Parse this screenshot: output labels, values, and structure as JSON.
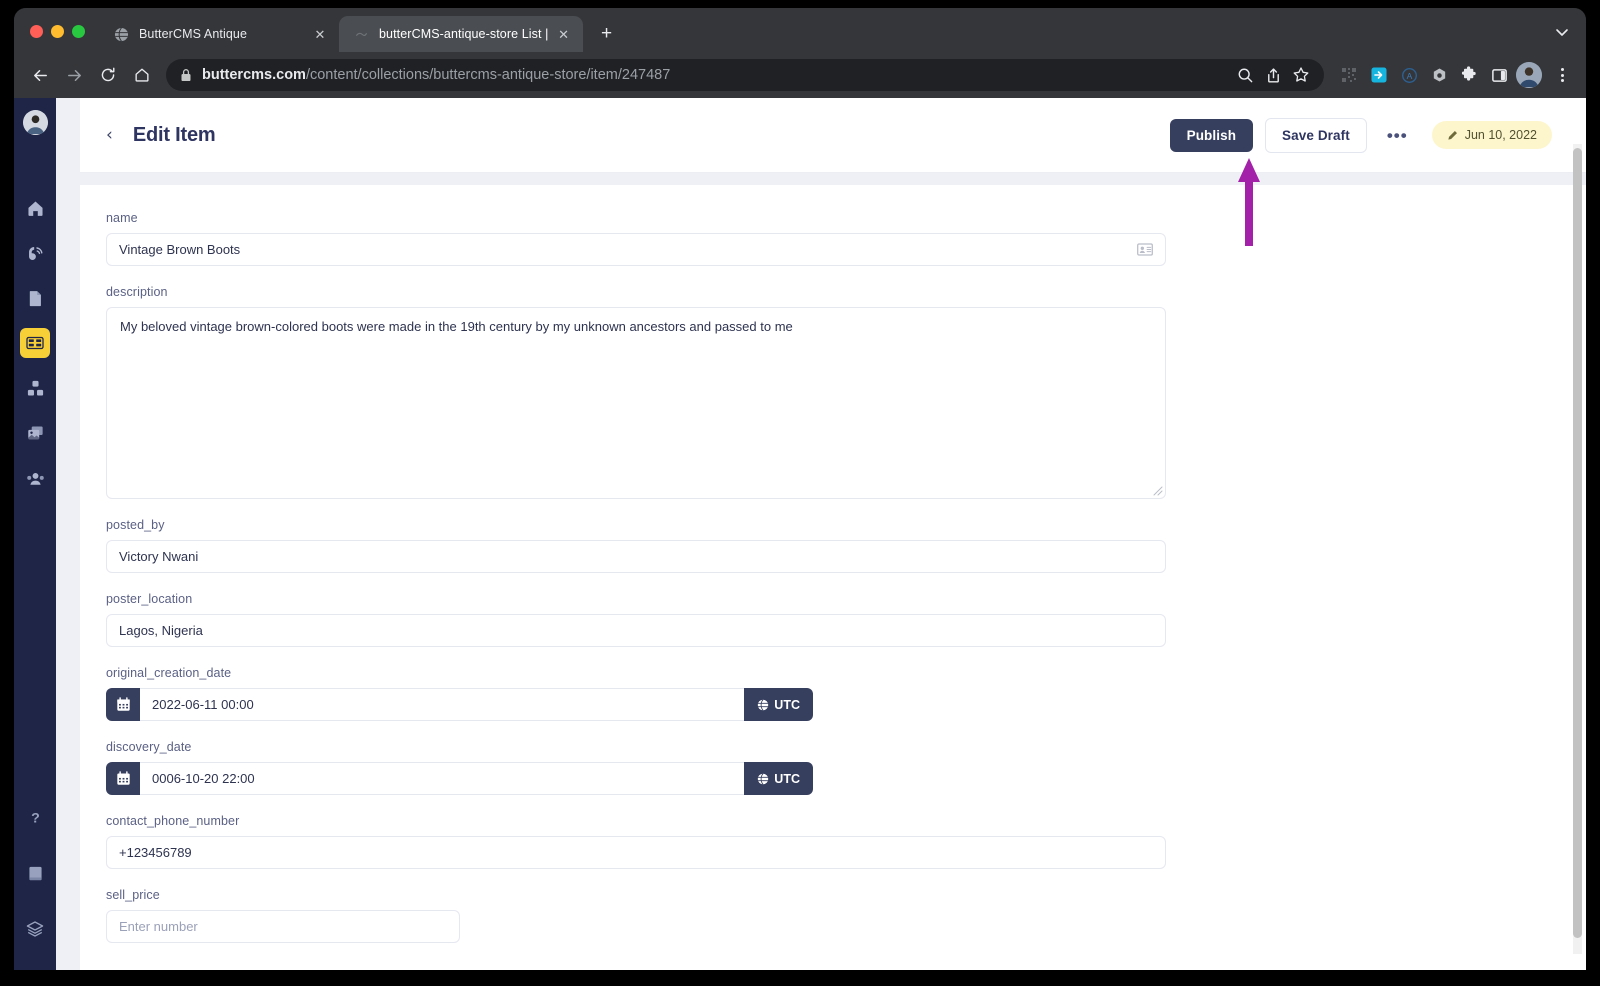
{
  "browser": {
    "window_controls": [
      "close",
      "minimize",
      "maximize"
    ],
    "tabs": [
      {
        "title": "ButterCMS Antique",
        "favicon": "globe-icon",
        "active": false
      },
      {
        "title": "butterCMS-antique-store List |",
        "favicon": "globe-icon",
        "active": true
      }
    ],
    "new_tab_label": "+",
    "tab_list_chevron": "chevron-down-icon",
    "nav": {
      "back": "back-arrow-icon",
      "forward": "forward-arrow-icon",
      "reload": "reload-icon",
      "home": "home-icon"
    },
    "omnibox": {
      "lock": "lock-icon",
      "url_domain": "buttercms.com",
      "url_path": "/content/collections/buttercms-antique-store/item/247487",
      "actions": [
        "search-icon",
        "share-icon",
        "bookmark-star-icon"
      ]
    },
    "extensions": [
      "qr-code-icon",
      "export-icon",
      "grammarly-icon",
      "nut-icon",
      "puzzle-extensions-icon",
      "side-panel-icon"
    ],
    "profile_avatar": "profile-avatar",
    "menu": "kebab-menu-icon"
  },
  "sidebar": {
    "avatar": "user-avatar",
    "items": [
      {
        "name": "home",
        "icon": "home-icon",
        "active": false
      },
      {
        "name": "blog",
        "icon": "blog-rss-icon",
        "active": false
      },
      {
        "name": "pages",
        "icon": "page-document-icon",
        "active": false
      },
      {
        "name": "collections",
        "icon": "collections-grid-icon",
        "active": true
      },
      {
        "name": "components",
        "icon": "components-blocks-icon",
        "active": false
      },
      {
        "name": "media",
        "icon": "media-images-icon",
        "active": false
      },
      {
        "name": "team",
        "icon": "team-users-icon",
        "active": false
      }
    ],
    "bottom_items": [
      {
        "name": "help",
        "icon": "question-mark-icon"
      },
      {
        "name": "docs",
        "icon": "book-icon"
      },
      {
        "name": "stack",
        "icon": "layers-stack-icon"
      }
    ]
  },
  "header": {
    "back_chevron": "chevron-left-icon",
    "title": "Edit Item",
    "publish_label": "Publish",
    "save_draft_label": "Save Draft",
    "more_label": "•••",
    "date_badge": {
      "icon": "pencil-icon",
      "text": "Jun 10, 2022"
    }
  },
  "annotation": {
    "arrow_color": "#a321a8",
    "points_at": "publish-button"
  },
  "form": {
    "fields": [
      {
        "key": "name",
        "label": "name",
        "type": "text",
        "value": "Vintage Brown Boots",
        "placeholder": "",
        "trailing_icon": "contact-card-autofill-icon"
      },
      {
        "key": "description",
        "label": "description",
        "type": "textarea",
        "value": "My beloved vintage brown-colored boots were made in the 19th century by my unknown ancestors and passed to me",
        "placeholder": ""
      },
      {
        "key": "posted_by",
        "label": "posted_by",
        "type": "text",
        "value": "Victory Nwani",
        "placeholder": ""
      },
      {
        "key": "poster_location",
        "label": "poster_location",
        "type": "text",
        "value": "Lagos, Nigeria",
        "placeholder": ""
      },
      {
        "key": "original_creation_date",
        "label": "original_creation_date",
        "type": "datetime",
        "value": "2022-06-11 00:00",
        "timezone": "UTC",
        "leading_icon": "calendar-icon",
        "timezone_icon": "globe-icon"
      },
      {
        "key": "discovery_date",
        "label": "discovery_date",
        "type": "datetime",
        "value": "0006-10-20 22:00",
        "timezone": "UTC",
        "leading_icon": "calendar-icon",
        "timezone_icon": "globe-icon"
      },
      {
        "key": "contact_phone_number",
        "label": "contact_phone_number",
        "type": "text",
        "value": "+123456789",
        "placeholder": ""
      },
      {
        "key": "sell_price",
        "label": "sell_price",
        "type": "number",
        "value": "",
        "placeholder": "Enter number"
      }
    ]
  },
  "colors": {
    "sidebar_bg": "#1e2547",
    "accent_yellow": "#f7d038",
    "button_navy": "#373f5e",
    "annotation_purple": "#a321a8",
    "badge_yellow": "#fdf6cd",
    "page_bg": "#eef0f5"
  }
}
